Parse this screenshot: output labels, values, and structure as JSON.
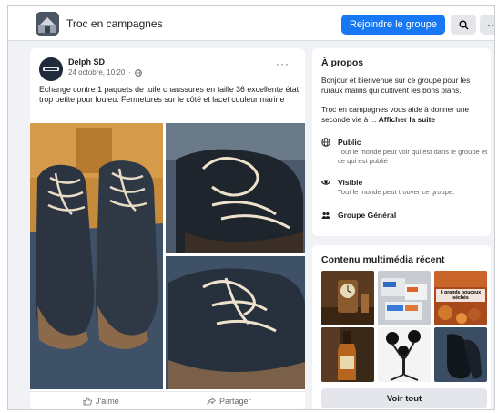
{
  "header": {
    "group_name": "Troc en campagnes",
    "join_label": "Rejoindre le groupe",
    "search_icon": "search-icon",
    "more_icon": "more-icon",
    "more_glyph": "···"
  },
  "post": {
    "author": "Delph SD",
    "timestamp": "24 octobre, 10:20",
    "meta_separator": "·",
    "text": "Echange contre 1 paquets de tuile chaussures en taille 36 excellente état trop petite pour louleu. Fermetures sur le côté et lacet couleur marine",
    "more_glyph": "···",
    "like_label": "J'aime",
    "share_label": "Partager"
  },
  "about": {
    "title": "À propos",
    "description": "Bonjour et bienvenue sur ce groupe pour les ruraux malins qui cultivent les bons plans.",
    "description2": "Troc en campagnes vous aide à donner une seconde vie à ...",
    "see_more": "Afficher la suite",
    "public_title": "Public",
    "public_desc": "Tout le monde peut voir qui est dans le groupe et ce qui est publié",
    "visible_title": "Visible",
    "visible_desc": "Tout le monde peut trouver ce groupe.",
    "group_type": "Groupe Général"
  },
  "media": {
    "title": "Contenu multimédia récent",
    "caption": "6 grands bouceux séchés",
    "see_all": "Voir tout"
  },
  "colors": {
    "accent": "#1877f2",
    "background": "#f0f2f5",
    "card": "#ffffff",
    "secondary_text": "#65676b"
  }
}
